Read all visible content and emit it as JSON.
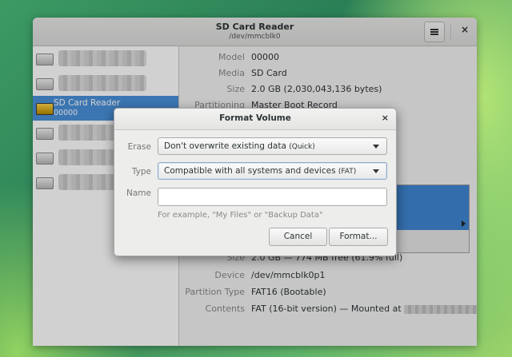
{
  "window": {
    "title": "SD Card Reader",
    "subtitle": "/dev/mmcblk0",
    "menu_icon": "hamburger-icon",
    "close_label": "×"
  },
  "sidebar": {
    "items": [
      {
        "label": "",
        "sublabel": "",
        "redacted": true,
        "icon": "drive-icon"
      },
      {
        "label": "",
        "sublabel": "",
        "redacted": true,
        "icon": "drive-icon"
      },
      {
        "label": "SD Card Reader",
        "sublabel": "00000",
        "selected": true,
        "icon": "sd-card-icon"
      },
      {
        "label": "",
        "sublabel": "",
        "redacted": true,
        "icon": "drive-icon"
      },
      {
        "label": "",
        "sublabel": "",
        "redacted": true,
        "icon": "drive-icon"
      },
      {
        "label": "",
        "sublabel": "",
        "redacted": true,
        "icon": "drive-icon"
      }
    ]
  },
  "drive": {
    "model_label": "Model",
    "model": "00000",
    "media_label": "Media",
    "media": "SD Card",
    "size_label": "Size",
    "size": "2.0 GB (2,030,043,136 bytes)",
    "partitioning_label": "Partitioning",
    "partitioning": "Master Boot Record"
  },
  "volume": {
    "size_label": "Size",
    "size": "2.0 GB — 774 MB free (61.9% full)",
    "device_label": "Device",
    "device": "/dev/mmcblk0p1",
    "ptype_label": "Partition Type",
    "ptype": "FAT16 (Bootable)",
    "contents_label": "Contents",
    "contents": "FAT (16-bit version) — Mounted at"
  },
  "dialog": {
    "title": "Format Volume",
    "close_label": "×",
    "erase_label": "Erase",
    "erase_value": "Don't overwrite existing data",
    "erase_suffix": "(Quick)",
    "type_label": "Type",
    "type_value": "Compatible with all systems and devices",
    "type_suffix": "(FAT)",
    "name_label": "Name",
    "name_value": "",
    "hint": "For example, \"My Files\" or \"Backup Data\"",
    "cancel_label": "Cancel",
    "format_label": "Format..."
  }
}
